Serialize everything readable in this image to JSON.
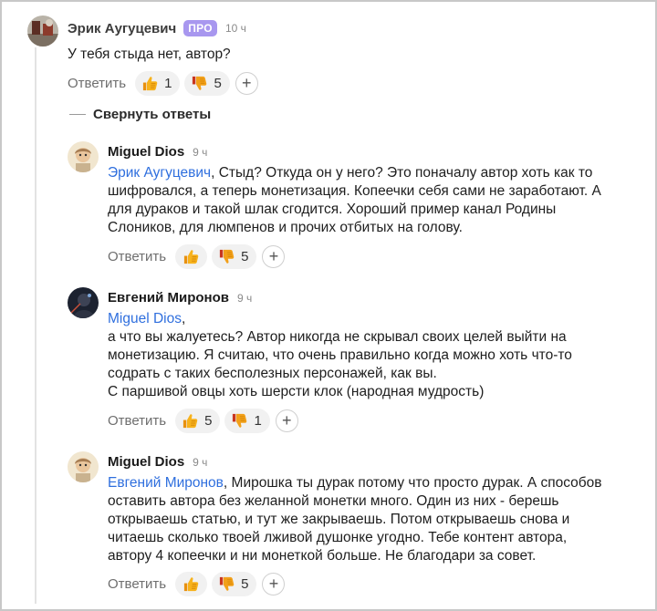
{
  "comments": [
    {
      "author": "Эрик Аугуцевич",
      "badge": "ПРО",
      "time": "10 ч",
      "lines": [
        "У тебя стыда нет, автор?"
      ],
      "reply_label": "Ответить",
      "likes": "1",
      "dislikes": "5"
    },
    {
      "author": "Miguel Dios",
      "time": "9 ч",
      "mention": "Эрик Аугуцевич",
      "first_line_rest": ", Стыд? Откуда он у него? Это поначалу автор хоть как то",
      "lines": [
        "шифровался, а теперь монетизация. Копеечки себя сами не заработают. А",
        "для дураков и такой шлак сгодится. Хороший пример канал Родины",
        "Слоников, для люмпенов и прочих отбитых на голову."
      ],
      "reply_label": "Ответить",
      "likes": "",
      "dislikes": "5"
    },
    {
      "author": "Евгений Миронов",
      "time": "9 ч",
      "mention": "Miguel Dios",
      "first_line_rest": ",",
      "lines": [
        "а что вы жалуетесь? Автор никогда не скрывал своих целей выйти на",
        "монетизацию. Я считаю, что очень правильно когда можно хоть что-то",
        "содрать с таких бесполезных персонажей, как вы.",
        "С паршивой овцы хоть шерсти клок (народная мудрость)"
      ],
      "reply_label": "Ответить",
      "likes": "5",
      "dislikes": "1"
    },
    {
      "author": "Miguel Dios",
      "time": "9 ч",
      "mention": "Евгений Миронов",
      "first_line_rest": ", Мирошка ты дурак потому что просто дурак. А способов",
      "lines": [
        "оставить автора без желанной монетки много. Один из них - берешь",
        "открываешь статью, и тут же закрываешь. Потом открываешь снова и",
        "читаешь сколько твоей лживой душонке угодно. Тебе контент автора,",
        "автору 4 копеечки и ни монеткой больше. Не благодари за совет."
      ],
      "reply_label": "Ответить",
      "likes": "",
      "dislikes": "5"
    }
  ],
  "collapse_label": "Свернуть ответы",
  "plus_symbol": "+",
  "colors": {
    "mention": "#2f6fde",
    "badge": "#a897ef",
    "reaction_bg": "#f1f1f1"
  },
  "icons": {
    "like": "thumbs-up-icon",
    "dislike": "thumbs-down-icon",
    "add": "plus-icon"
  }
}
